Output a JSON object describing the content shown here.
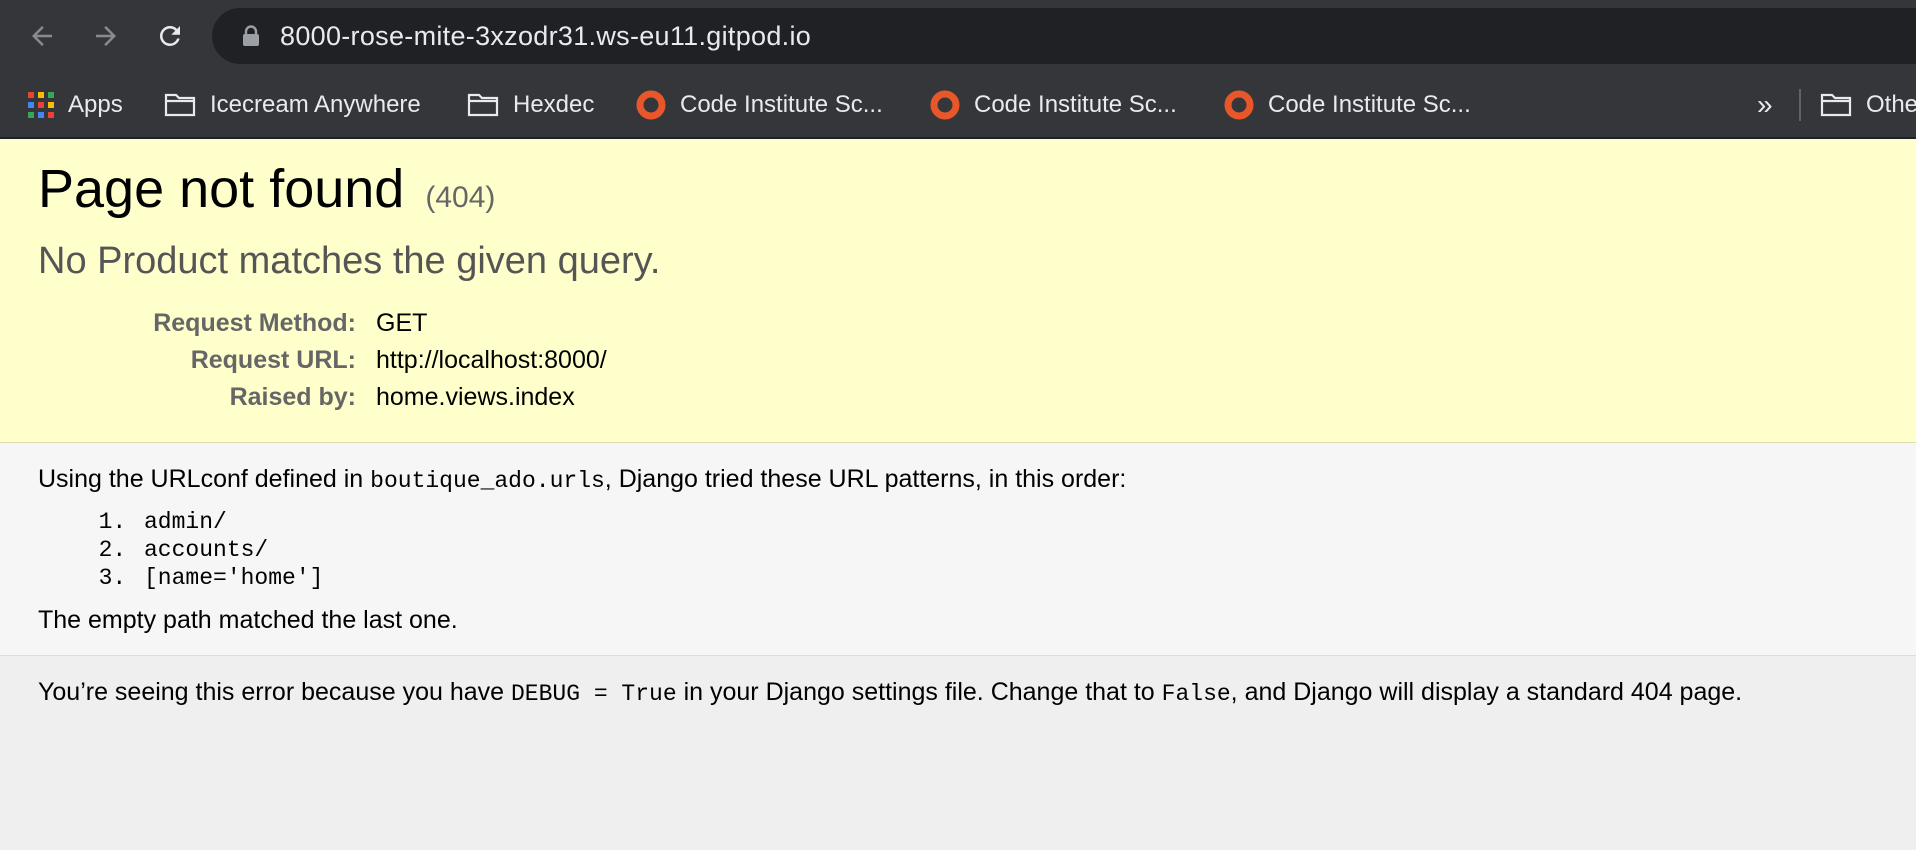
{
  "browser": {
    "url": "8000-rose-mite-3xzodr31.ws-eu11.gitpod.io",
    "bookmarks": [
      {
        "label": "Apps",
        "icon": "apps-grid-icon"
      },
      {
        "label": "Icecream Anywhere",
        "icon": "folder-icon"
      },
      {
        "label": "Hexdec",
        "icon": "folder-icon"
      },
      {
        "label": "Code Institute Sc...",
        "icon": "code-institute-icon"
      },
      {
        "label": "Code Institute Sc...",
        "icon": "code-institute-icon"
      },
      {
        "label": "Code Institute Sc...",
        "icon": "code-institute-icon"
      }
    ],
    "overflow_label": "»",
    "other_bookmarks_label": "Othe"
  },
  "summary": {
    "title": "Page not found",
    "code": "(404)",
    "message": "No Product matches the given query.",
    "request_method_label": "Request Method:",
    "request_method": "GET",
    "request_url_label": "Request URL:",
    "request_url": "http://localhost:8000/",
    "raised_by_label": "Raised by:",
    "raised_by": "home.views.index"
  },
  "info": {
    "intro_before": "Using the URLconf defined in ",
    "urlconf": "boutique_ado.urls",
    "intro_after": ", Django tried these URL patterns, in this order:",
    "patterns": [
      "admin/",
      "accounts/",
      "[name='home']"
    ],
    "result": "The empty path matched the last one."
  },
  "explanation": {
    "part1": "You’re seeing this error because you have ",
    "code1": "DEBUG = True",
    "part2": " in your Django settings file. Change that to ",
    "code2": "False",
    "part3": ", and Django will display a standard 404 page."
  },
  "colors": {
    "chrome": "#35363a",
    "omnibox": "#202124",
    "summary_bg": "#ffffcc",
    "info_bg": "#f6f6f6",
    "page_bg": "#efefef",
    "ci_icon": "#e8572a"
  }
}
